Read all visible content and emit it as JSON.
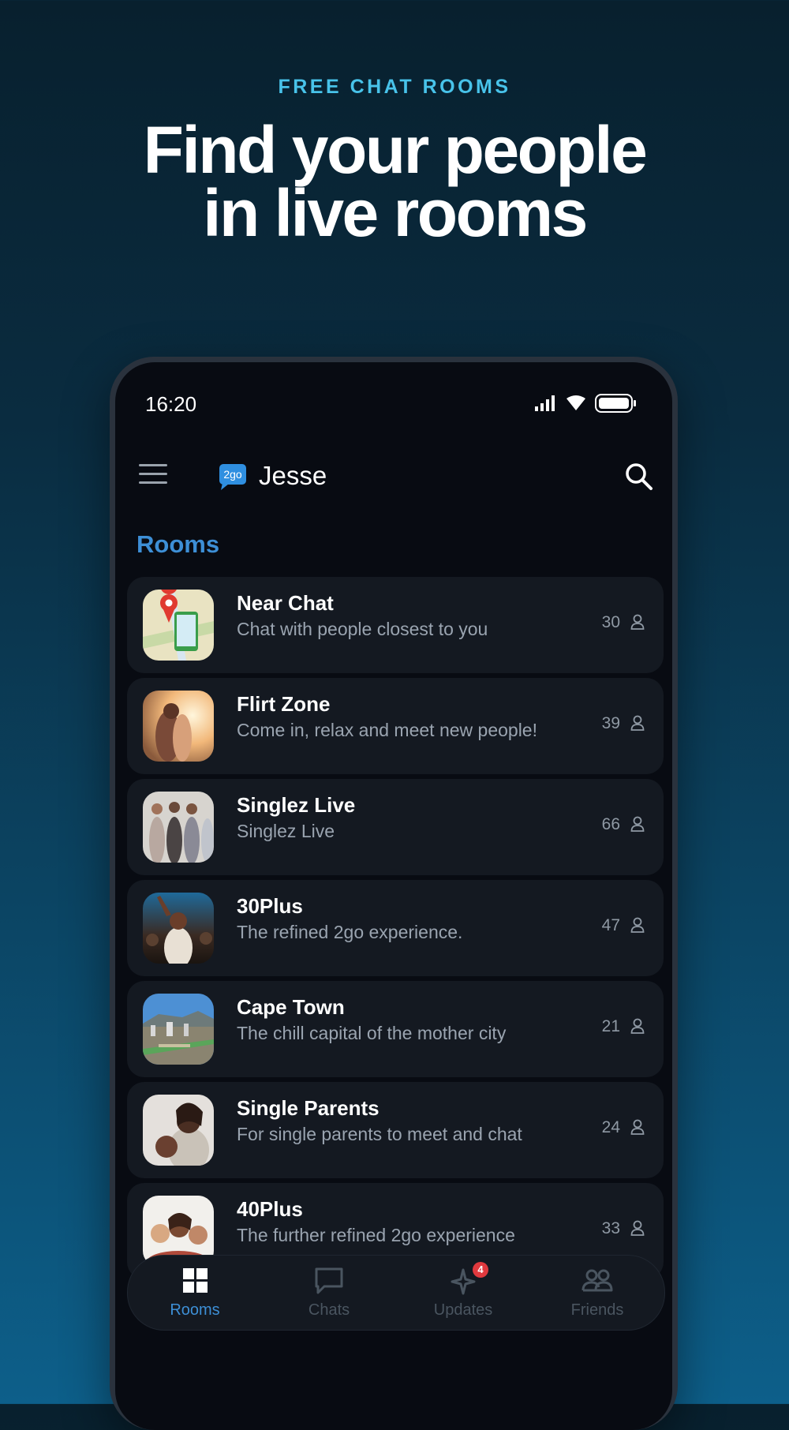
{
  "promo": {
    "eyebrow": "FREE CHAT ROOMS",
    "headline_line1": "Find your people",
    "headline_line2": "in live rooms"
  },
  "status_bar": {
    "time": "16:20",
    "icons": [
      "signal-icon",
      "wifi-icon",
      "battery-icon"
    ]
  },
  "header": {
    "menu_icon": "hamburger-menu-icon",
    "logo_text": "2go",
    "user_name": "Jesse",
    "search_icon": "search-icon"
  },
  "section_title": "Rooms",
  "rooms": [
    {
      "name": "Near Chat",
      "description": "Chat with people closest to you",
      "count": "30",
      "thumb": "map-pin-phone"
    },
    {
      "name": "Flirt Zone",
      "description": "Come in, relax and meet new people!",
      "count": "39",
      "thumb": "couple-sunset"
    },
    {
      "name": "Singlez Live",
      "description": "Singlez Live",
      "count": "66",
      "thumb": "group-women"
    },
    {
      "name": "30Plus",
      "description": "The refined 2go experience.",
      "count": "47",
      "thumb": "party-crowd"
    },
    {
      "name": "Cape Town",
      "description": "The chill capital of the mother city",
      "count": "21",
      "thumb": "city-aerial"
    },
    {
      "name": "Single Parents",
      "description": "For single parents to meet and chat",
      "count": "24",
      "thumb": "parent-child"
    },
    {
      "name": "40Plus",
      "description": "The further refined 2go experience",
      "count": "33",
      "thumb": "friends-group"
    }
  ],
  "nav": [
    {
      "label": "Rooms",
      "icon": "grid-icon",
      "active": true
    },
    {
      "label": "Chats",
      "icon": "chat-bubble-icon",
      "active": false
    },
    {
      "label": "Updates",
      "icon": "sparkle-icon",
      "active": false,
      "badge": "4"
    },
    {
      "label": "Friends",
      "icon": "friends-icon",
      "active": false
    }
  ],
  "colors": {
    "accent": "#3d8fd6",
    "eyebrow": "#48c3ea",
    "badge": "#e0393e",
    "card": "#141921",
    "screen": "#080b12"
  }
}
